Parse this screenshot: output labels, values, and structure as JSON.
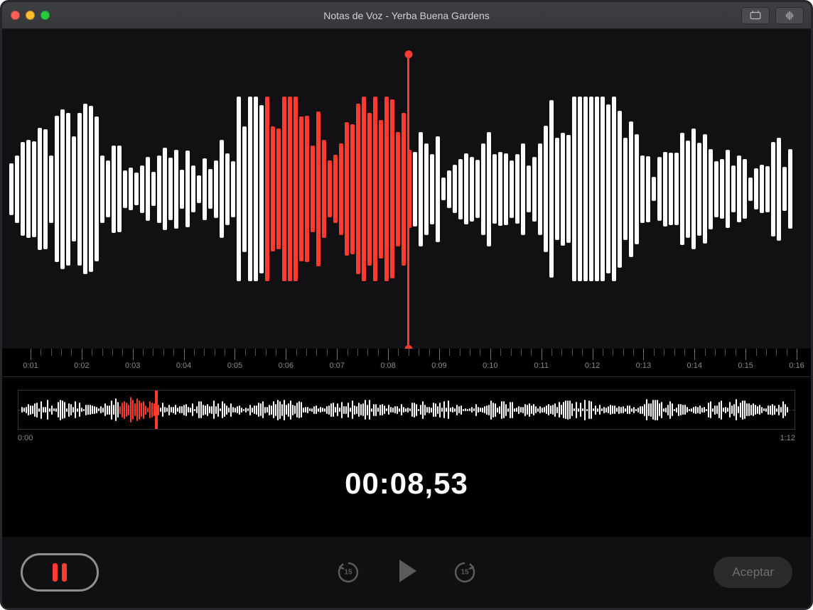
{
  "window": {
    "title": "Notas de Voz - Yerba Buena Gardens"
  },
  "colors": {
    "accent": "#ff3b30",
    "bg": "#111113",
    "text_muted": "#8a8b8d"
  },
  "toolbar": {
    "trim_tool": "trim",
    "enhance_tool": "enhance"
  },
  "ruler": {
    "labels": [
      "0:01",
      "0:02",
      "0:03",
      "0:04",
      "0:05",
      "0:06",
      "0:07",
      "0:08",
      "0:09",
      "0:10",
      "0:11",
      "0:12",
      "0:13",
      "0:14",
      "0:15",
      "0:16"
    ]
  },
  "overview": {
    "start": "0:00",
    "end": "1:12"
  },
  "playback": {
    "current_time": "00:08,53",
    "skip_seconds": "15"
  },
  "controls": {
    "accept_label": "Aceptar"
  }
}
